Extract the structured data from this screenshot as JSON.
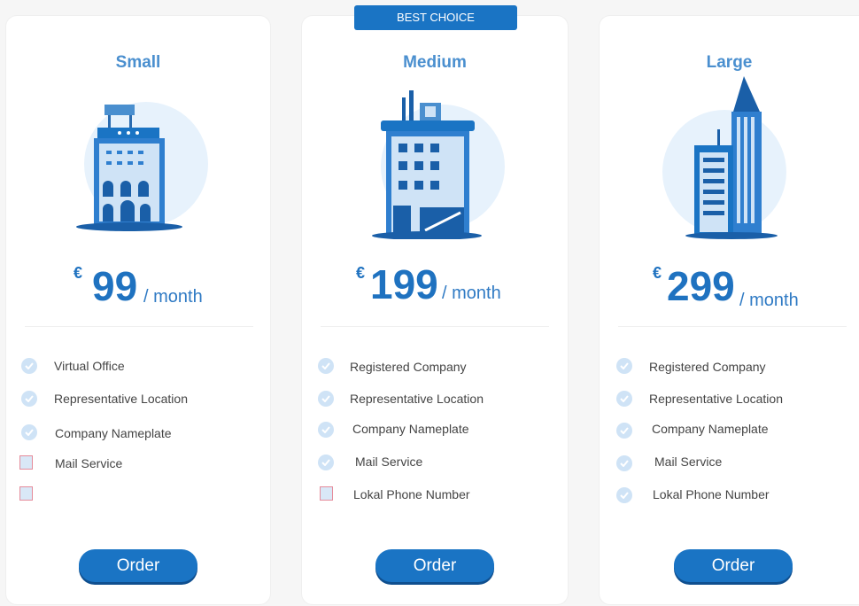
{
  "badge": "BEST CHOICE",
  "currency_symbol": "€",
  "per_label": "/ month",
  "plans": [
    {
      "name": "Small",
      "amount": "99",
      "features": [
        "Virtual Office",
        "Representative Location",
        "Company Nameplate",
        "Mail Service"
      ],
      "order_label": "Order"
    },
    {
      "name": "Medium",
      "amount": "199",
      "features": [
        "Registered Company",
        "Representative Location",
        "Company Nameplate",
        "Mail Service",
        "Lokal Phone Number"
      ],
      "order_label": "Order"
    },
    {
      "name": "Large",
      "amount": "299",
      "features": [
        "Registered Company",
        "Representative Location",
        "Company Nameplate",
        "Mail Service",
        "Lokal Phone Number"
      ],
      "order_label": "Order"
    }
  ],
  "colors": {
    "accent": "#1a74c4",
    "title": "#4a8fcf",
    "check_bg": "#cfe3f6"
  }
}
